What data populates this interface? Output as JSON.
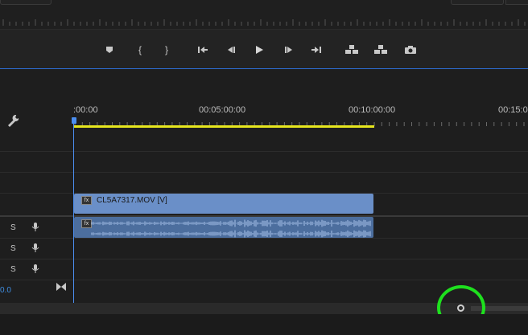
{
  "transport": {
    "buttons": [
      {
        "name": "add-marker-button",
        "glyph": "⬟"
      },
      {
        "name": "mark-in-button",
        "glyph": "{"
      },
      {
        "name": "mark-out-button",
        "glyph": "}"
      },
      {
        "name": "go-to-in-button",
        "glyph": "|←"
      },
      {
        "name": "step-back-button",
        "glyph": "◀|"
      },
      {
        "name": "play-button",
        "glyph": "▶"
      },
      {
        "name": "step-forward-button",
        "glyph": "|▶"
      },
      {
        "name": "go-to-out-button",
        "glyph": "→|"
      },
      {
        "name": "lift-button",
        "glyph": "⧉"
      },
      {
        "name": "extract-button",
        "glyph": "⧉"
      },
      {
        "name": "export-frame-button",
        "glyph": "📷"
      }
    ]
  },
  "ruler": {
    "labels": [
      ":00:00",
      "00:05:00:00",
      "00:10:00:00",
      "00:15:0"
    ]
  },
  "tracks": {
    "solo_label": "S",
    "timecode": "0.0"
  },
  "clips": {
    "video_name": "CL5A7317.MOV [V]",
    "fx": "fx"
  },
  "colors": {
    "accent": "#2d6cd2",
    "video_clip": "#6a8fc8",
    "audio_clip": "#4c6e9e",
    "work_area": "#e6e61e",
    "highlight_ring": "#1ee01e"
  }
}
